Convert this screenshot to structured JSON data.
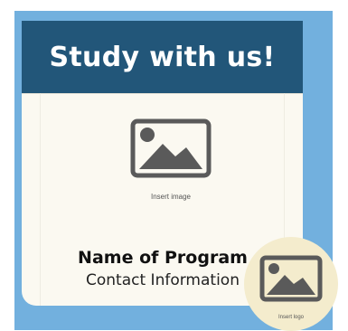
{
  "banner": {
    "title": "Study with us!"
  },
  "image_placeholder": {
    "icon": "image-icon",
    "caption": "Insert image"
  },
  "program": {
    "name": "Name of Program",
    "contact": "Contact Information"
  },
  "logo_placeholder": {
    "icon": "image-icon",
    "caption": "Insert logo"
  },
  "colors": {
    "frame": "#72b0de",
    "banner": "#225679",
    "card": "#fbf9f1",
    "logo_circle": "#f4eccd",
    "icon": "#5a5a5a"
  }
}
